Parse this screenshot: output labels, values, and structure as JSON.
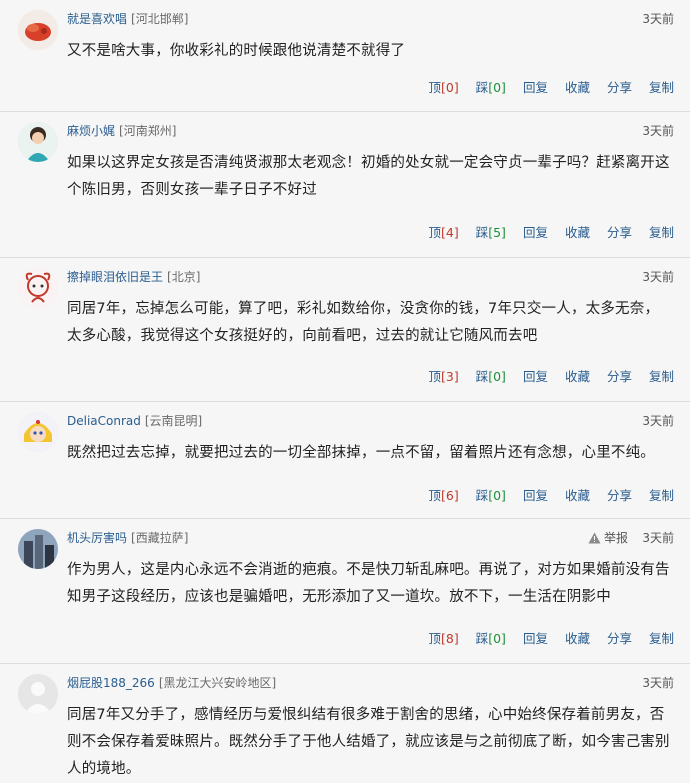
{
  "comments": [
    {
      "user": "就是喜欢唱",
      "location": "[河北邯郸]",
      "time": "3天前",
      "text": "又不是啥大事，你收彩礼的时候跟他说清楚不就得了",
      "up_label": "顶",
      "up_count": "[0]",
      "down_label": "踩",
      "down_count": "[0]",
      "reply": "回复",
      "fav": "收藏",
      "share": "分享",
      "copy": "复制"
    },
    {
      "user": "麻烦小娓",
      "location": "[河南郑州]",
      "time": "3天前",
      "text": "如果以这界定女孩是否清纯贤淑那太老观念！初婚的处女就一定会守贞一辈子吗？赶紧离开这个陈旧男，否则女孩一辈子日子不好过",
      "up_label": "顶",
      "up_count": "[4]",
      "down_label": "踩",
      "down_count": "[5]",
      "reply": "回复",
      "fav": "收藏",
      "share": "分享",
      "copy": "复制"
    },
    {
      "user": "擦掉眼泪依旧是王",
      "location": "[北京]",
      "time": "3天前",
      "text": "同居7年，忘掉怎么可能，算了吧，彩礼如数给你，没贪你的钱，7年只交一人，太多无奈，太多心酸，我觉得这个女孩挺好的，向前看吧，过去的就让它随风而去吧",
      "up_label": "顶",
      "up_count": "[3]",
      "down_label": "踩",
      "down_count": "[0]",
      "reply": "回复",
      "fav": "收藏",
      "share": "分享",
      "copy": "复制"
    },
    {
      "user": "DeliaConrad",
      "location": "[云南昆明]",
      "time": "3天前",
      "text": "既然把过去忘掉，就要把过去的一切全部抹掉，一点不留，留着照片还有念想，心里不纯。",
      "up_label": "顶",
      "up_count": "[6]",
      "down_label": "踩",
      "down_count": "[0]",
      "reply": "回复",
      "fav": "收藏",
      "share": "分享",
      "copy": "复制"
    },
    {
      "user": "机头厉害吗",
      "location": "[西藏拉萨]",
      "time": "3天前",
      "report": "举报",
      "text": "作为男人，这是内心永远不会消逝的疤痕。不是快刀斩乱麻吧。再说了，对方如果婚前没有告知男子这段经历，应该也是骗婚吧，无形添加了又一道坎。放不下，一生活在阴影中",
      "up_label": "顶",
      "up_count": "[8]",
      "down_label": "踩",
      "down_count": "[0]",
      "reply": "回复",
      "fav": "收藏",
      "share": "分享",
      "copy": "复制"
    },
    {
      "user": "烟屁股188_266",
      "location": "[黑龙江大兴安岭地区]",
      "time": "3天前",
      "text": "同居7年又分手了，感情经历与爱恨纠结有很多难于割舍的思绪，心中始终保存着前男友，否则不会保存着爱昧照片。既然分手了于他人结婚了，就应该是与之前彻底了断，如今害己害别人的境地。"
    }
  ]
}
